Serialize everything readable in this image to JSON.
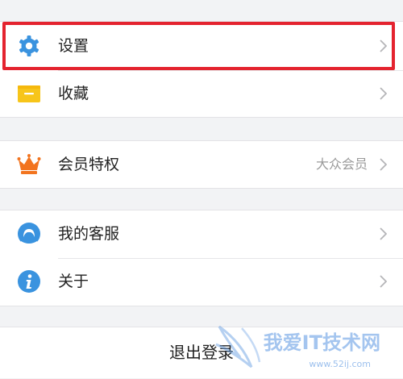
{
  "colors": {
    "accent_blue": "#3a93df",
    "folder_yellow": "#f7c51a",
    "crown_orange": "#f2741f",
    "highlight_red": "#e4232f"
  },
  "menu": {
    "settings": {
      "label": "设置",
      "icon": "gear-icon"
    },
    "favorites": {
      "label": "收藏",
      "icon": "folder-icon"
    },
    "vip": {
      "label": "会员特权",
      "value": "大众会员",
      "icon": "crown-icon"
    },
    "support": {
      "label": "我的客服",
      "icon": "headset-icon"
    },
    "about": {
      "label": "关于",
      "icon": "info-icon"
    }
  },
  "logout": {
    "label": "退出登录"
  },
  "watermark": {
    "text": "我爱IT技术网",
    "url": "www.52ij.com"
  }
}
